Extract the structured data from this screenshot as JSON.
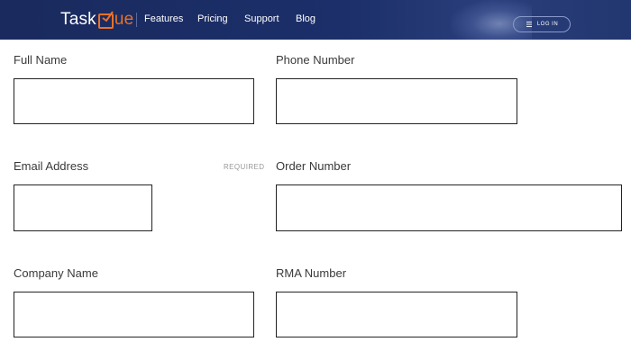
{
  "header": {
    "logo": {
      "prefix": "Task",
      "suffix": "ue"
    },
    "nav": [
      {
        "label": "Features"
      },
      {
        "label": "Pricing"
      },
      {
        "label": "Support"
      },
      {
        "label": "Blog"
      }
    ],
    "login_label": "LOG IN",
    "colors": {
      "nav_bg": "#1c2f6a",
      "brand_accent": "#e8712a"
    }
  },
  "form": {
    "full_name": {
      "label": "Full Name",
      "value": ""
    },
    "phone_number": {
      "label": "Phone Number",
      "value": ""
    },
    "email_address": {
      "label": "Email Address",
      "required_text": "REQUIRED",
      "value": ""
    },
    "order_number": {
      "label": "Order Number",
      "value": ""
    },
    "company_name": {
      "label": "Company Name",
      "value": ""
    },
    "rma_number": {
      "label": "RMA Number",
      "value": ""
    }
  }
}
